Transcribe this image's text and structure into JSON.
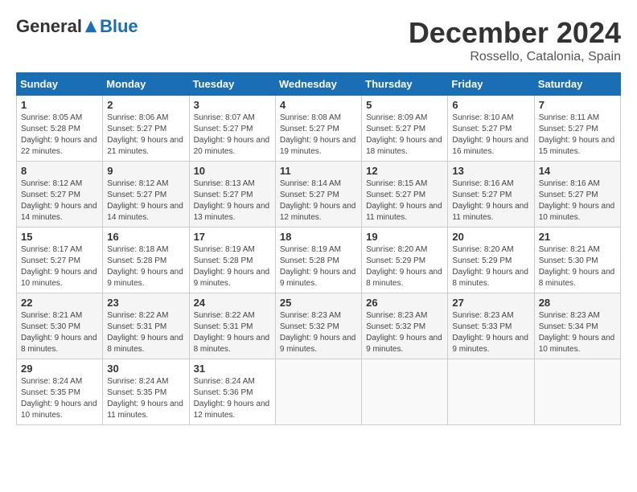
{
  "header": {
    "logo": {
      "general": "General",
      "blue": "Blue"
    },
    "title": "December 2024",
    "location": "Rossello, Catalonia, Spain"
  },
  "weekdays": [
    "Sunday",
    "Monday",
    "Tuesday",
    "Wednesday",
    "Thursday",
    "Friday",
    "Saturday"
  ],
  "weeks": [
    [
      {
        "day": "1",
        "sunrise": "Sunrise: 8:05 AM",
        "sunset": "Sunset: 5:28 PM",
        "daylight": "Daylight: 9 hours and 22 minutes."
      },
      {
        "day": "2",
        "sunrise": "Sunrise: 8:06 AM",
        "sunset": "Sunset: 5:27 PM",
        "daylight": "Daylight: 9 hours and 21 minutes."
      },
      {
        "day": "3",
        "sunrise": "Sunrise: 8:07 AM",
        "sunset": "Sunset: 5:27 PM",
        "daylight": "Daylight: 9 hours and 20 minutes."
      },
      {
        "day": "4",
        "sunrise": "Sunrise: 8:08 AM",
        "sunset": "Sunset: 5:27 PM",
        "daylight": "Daylight: 9 hours and 19 minutes."
      },
      {
        "day": "5",
        "sunrise": "Sunrise: 8:09 AM",
        "sunset": "Sunset: 5:27 PM",
        "daylight": "Daylight: 9 hours and 18 minutes."
      },
      {
        "day": "6",
        "sunrise": "Sunrise: 8:10 AM",
        "sunset": "Sunset: 5:27 PM",
        "daylight": "Daylight: 9 hours and 16 minutes."
      },
      {
        "day": "7",
        "sunrise": "Sunrise: 8:11 AM",
        "sunset": "Sunset: 5:27 PM",
        "daylight": "Daylight: 9 hours and 15 minutes."
      }
    ],
    [
      {
        "day": "8",
        "sunrise": "Sunrise: 8:12 AM",
        "sunset": "Sunset: 5:27 PM",
        "daylight": "Daylight: 9 hours and 14 minutes."
      },
      {
        "day": "9",
        "sunrise": "Sunrise: 8:12 AM",
        "sunset": "Sunset: 5:27 PM",
        "daylight": "Daylight: 9 hours and 14 minutes."
      },
      {
        "day": "10",
        "sunrise": "Sunrise: 8:13 AM",
        "sunset": "Sunset: 5:27 PM",
        "daylight": "Daylight: 9 hours and 13 minutes."
      },
      {
        "day": "11",
        "sunrise": "Sunrise: 8:14 AM",
        "sunset": "Sunset: 5:27 PM",
        "daylight": "Daylight: 9 hours and 12 minutes."
      },
      {
        "day": "12",
        "sunrise": "Sunrise: 8:15 AM",
        "sunset": "Sunset: 5:27 PM",
        "daylight": "Daylight: 9 hours and 11 minutes."
      },
      {
        "day": "13",
        "sunrise": "Sunrise: 8:16 AM",
        "sunset": "Sunset: 5:27 PM",
        "daylight": "Daylight: 9 hours and 11 minutes."
      },
      {
        "day": "14",
        "sunrise": "Sunrise: 8:16 AM",
        "sunset": "Sunset: 5:27 PM",
        "daylight": "Daylight: 9 hours and 10 minutes."
      }
    ],
    [
      {
        "day": "15",
        "sunrise": "Sunrise: 8:17 AM",
        "sunset": "Sunset: 5:27 PM",
        "daylight": "Daylight: 9 hours and 10 minutes."
      },
      {
        "day": "16",
        "sunrise": "Sunrise: 8:18 AM",
        "sunset": "Sunset: 5:28 PM",
        "daylight": "Daylight: 9 hours and 9 minutes."
      },
      {
        "day": "17",
        "sunrise": "Sunrise: 8:19 AM",
        "sunset": "Sunset: 5:28 PM",
        "daylight": "Daylight: 9 hours and 9 minutes."
      },
      {
        "day": "18",
        "sunrise": "Sunrise: 8:19 AM",
        "sunset": "Sunset: 5:28 PM",
        "daylight": "Daylight: 9 hours and 9 minutes."
      },
      {
        "day": "19",
        "sunrise": "Sunrise: 8:20 AM",
        "sunset": "Sunset: 5:29 PM",
        "daylight": "Daylight: 9 hours and 8 minutes."
      },
      {
        "day": "20",
        "sunrise": "Sunrise: 8:20 AM",
        "sunset": "Sunset: 5:29 PM",
        "daylight": "Daylight: 9 hours and 8 minutes."
      },
      {
        "day": "21",
        "sunrise": "Sunrise: 8:21 AM",
        "sunset": "Sunset: 5:30 PM",
        "daylight": "Daylight: 9 hours and 8 minutes."
      }
    ],
    [
      {
        "day": "22",
        "sunrise": "Sunrise: 8:21 AM",
        "sunset": "Sunset: 5:30 PM",
        "daylight": "Daylight: 9 hours and 8 minutes."
      },
      {
        "day": "23",
        "sunrise": "Sunrise: 8:22 AM",
        "sunset": "Sunset: 5:31 PM",
        "daylight": "Daylight: 9 hours and 8 minutes."
      },
      {
        "day": "24",
        "sunrise": "Sunrise: 8:22 AM",
        "sunset": "Sunset: 5:31 PM",
        "daylight": "Daylight: 9 hours and 8 minutes."
      },
      {
        "day": "25",
        "sunrise": "Sunrise: 8:23 AM",
        "sunset": "Sunset: 5:32 PM",
        "daylight": "Daylight: 9 hours and 9 minutes."
      },
      {
        "day": "26",
        "sunrise": "Sunrise: 8:23 AM",
        "sunset": "Sunset: 5:32 PM",
        "daylight": "Daylight: 9 hours and 9 minutes."
      },
      {
        "day": "27",
        "sunrise": "Sunrise: 8:23 AM",
        "sunset": "Sunset: 5:33 PM",
        "daylight": "Daylight: 9 hours and 9 minutes."
      },
      {
        "day": "28",
        "sunrise": "Sunrise: 8:23 AM",
        "sunset": "Sunset: 5:34 PM",
        "daylight": "Daylight: 9 hours and 10 minutes."
      }
    ],
    [
      {
        "day": "29",
        "sunrise": "Sunrise: 8:24 AM",
        "sunset": "Sunset: 5:35 PM",
        "daylight": "Daylight: 9 hours and 10 minutes."
      },
      {
        "day": "30",
        "sunrise": "Sunrise: 8:24 AM",
        "sunset": "Sunset: 5:35 PM",
        "daylight": "Daylight: 9 hours and 11 minutes."
      },
      {
        "day": "31",
        "sunrise": "Sunrise: 8:24 AM",
        "sunset": "Sunset: 5:36 PM",
        "daylight": "Daylight: 9 hours and 12 minutes."
      },
      null,
      null,
      null,
      null
    ]
  ]
}
